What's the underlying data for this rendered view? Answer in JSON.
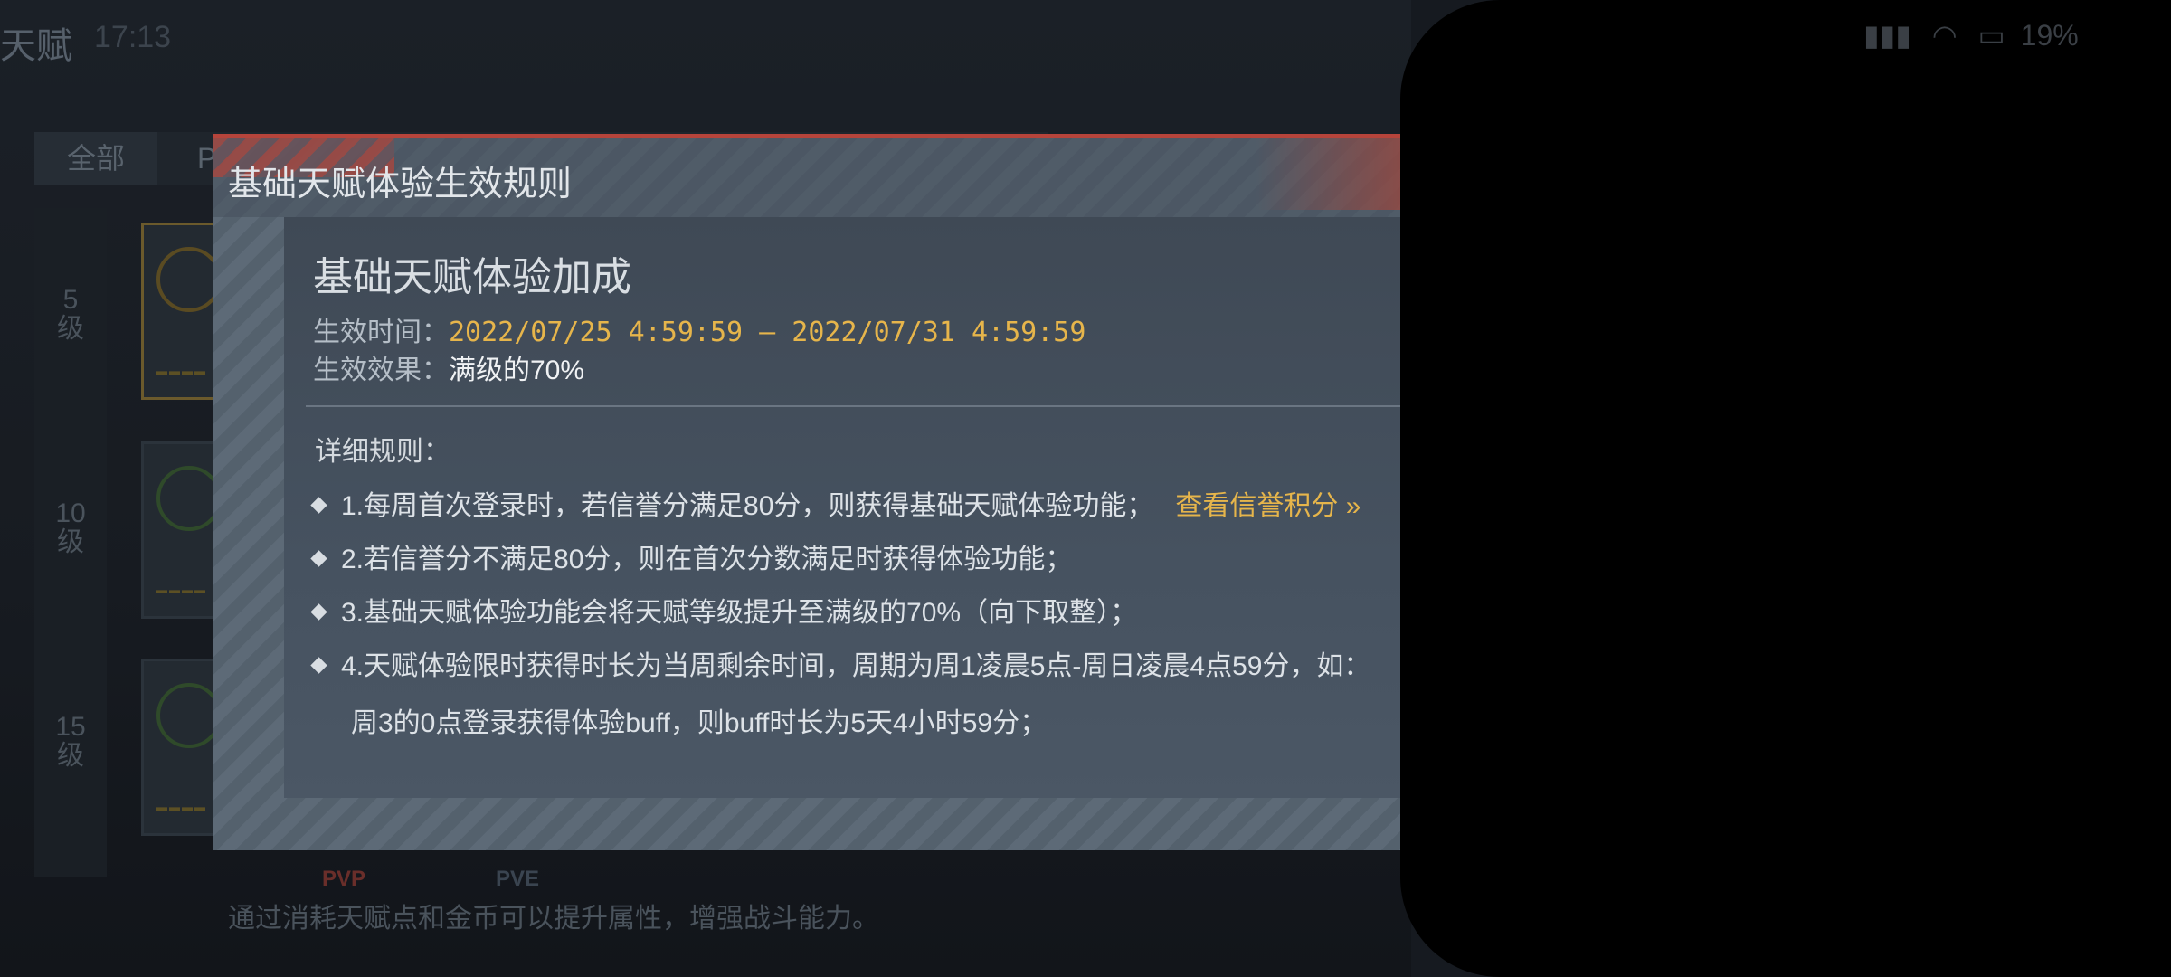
{
  "background": {
    "page_title": "天赋",
    "clock": "17:13",
    "tabs": [
      {
        "label": "全部"
      },
      {
        "label": "P"
      }
    ],
    "levels": [
      {
        "num": "5",
        "unit": "级"
      },
      {
        "num": "10",
        "unit": "级"
      },
      {
        "num": "15",
        "unit": "级"
      }
    ],
    "mode_tags": [
      "PVP",
      "PVE"
    ],
    "description": "通过消耗天赋点和金币可以提升属性，增强战斗能力。"
  },
  "status_bar": {
    "battery_text": "19%"
  },
  "modal": {
    "title": "基础天赋体验生效规则",
    "heading": "基础天赋体验加成",
    "time_label": "生效时间：",
    "time_value": "2022/07/25 4:59:59 — 2022/07/31 4:59:59",
    "effect_label": "生效效果：",
    "effect_value": "满级的70%",
    "rules_heading": "详细规则：",
    "rules": [
      {
        "text": "1.每周首次登录时，若信誉分满足80分，则获得基础天赋体验功能；",
        "link": "查看信誉积分 »"
      },
      {
        "text": "2.若信誉分不满足80分，则在首次分数满足时获得体验功能；"
      },
      {
        "text": "3.基础天赋体验功能会将天赋等级提升至满级的70%（向下取整）；"
      },
      {
        "text": "4.天赋体验限时获得时长为当周剩余时间，周期为周1凌晨5点-周日凌晨4点59分，如：",
        "continuation": "周3的0点登录获得体验buff，则buff时长为5天4小时59分；"
      }
    ]
  },
  "colors": {
    "accent_gold": "#e6b54b",
    "header_red": "#b6443b"
  }
}
